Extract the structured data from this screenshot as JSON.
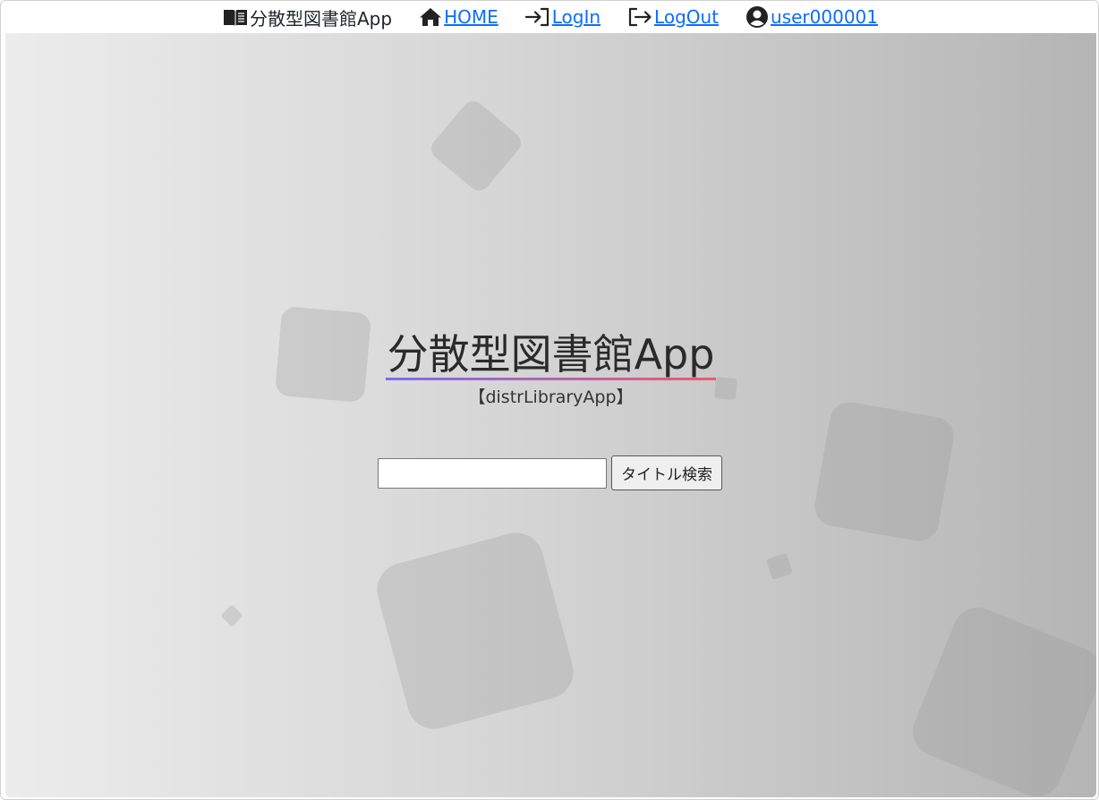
{
  "nav": {
    "brand": {
      "icon": "book-open-icon",
      "label": "分散型図書館App"
    },
    "items": [
      {
        "icon": "home-icon",
        "label": "HOME"
      },
      {
        "icon": "login-icon",
        "label": "LogIn"
      },
      {
        "icon": "logout-icon",
        "label": "LogOut"
      },
      {
        "icon": "user-circle-icon",
        "label": "user000001"
      }
    ],
    "link_color": "#0d6efd"
  },
  "hero": {
    "title": "分散型図書館App",
    "subtitle": "【distrLibraryApp】",
    "title_underline_colors": [
      "#7b6cf0",
      "#f05a6e"
    ]
  },
  "search": {
    "input_value": "",
    "button_label": "タイトル検索"
  }
}
